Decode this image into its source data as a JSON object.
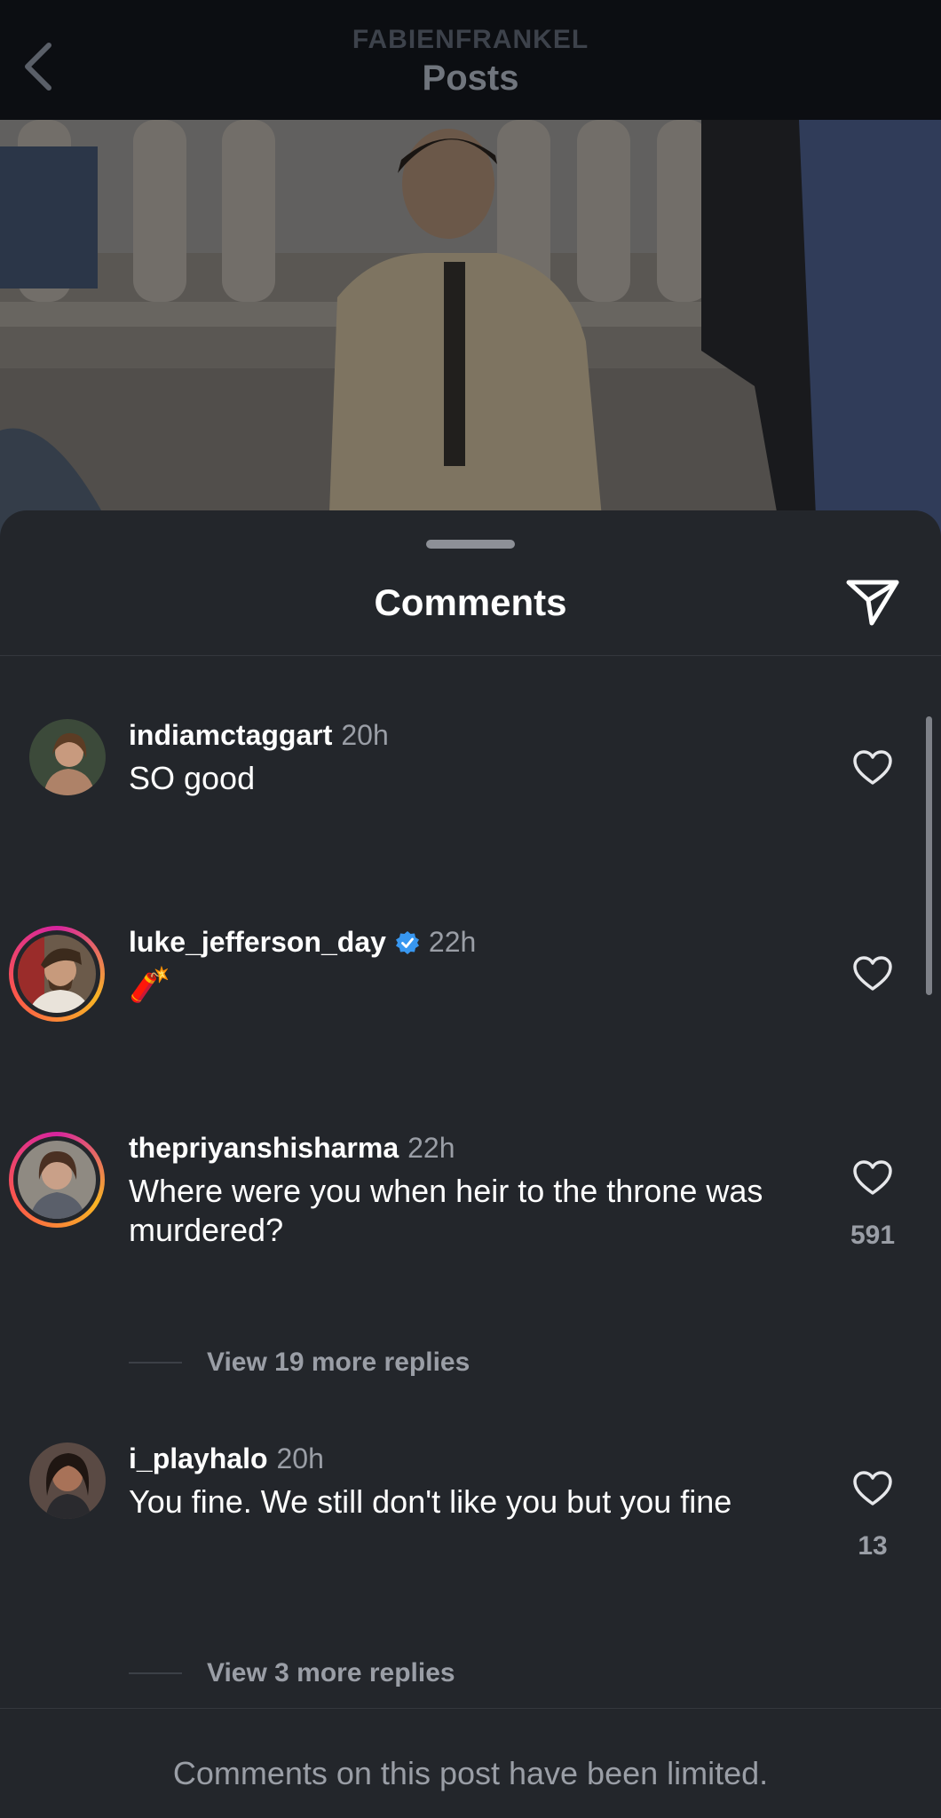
{
  "header": {
    "username": "FABIENFRANKEL",
    "title": "Posts"
  },
  "sheet": {
    "title": "Comments"
  },
  "comments": [
    {
      "username": "indiamctaggart",
      "time": "20h",
      "text": "SO good",
      "verified": false,
      "story_ring": false
    },
    {
      "username": "luke_jefferson_day",
      "time": "22h",
      "text": "🧨",
      "verified": true,
      "story_ring": true
    },
    {
      "username": "thepriyanshisharma",
      "time": "22h",
      "text": "Where were you when heir to the throne was murdered?",
      "likes": "591",
      "replies_label": "View 19 more replies",
      "verified": false,
      "story_ring": true
    },
    {
      "username": "i_playhalo",
      "time": "20h",
      "text": "You fine. We still don't like you but you fine",
      "likes": "13",
      "replies_label": "View 3 more replies",
      "verified": false,
      "story_ring": false
    }
  ],
  "footer": {
    "notice": "Comments on this post have been limited."
  },
  "colors": {
    "background": "#23262b",
    "verified_badge": "#3897f0",
    "secondary_text": "#9a9ea6"
  },
  "icons": [
    "back-chevron-icon",
    "share-icon",
    "heart-icon",
    "verified-icon"
  ]
}
